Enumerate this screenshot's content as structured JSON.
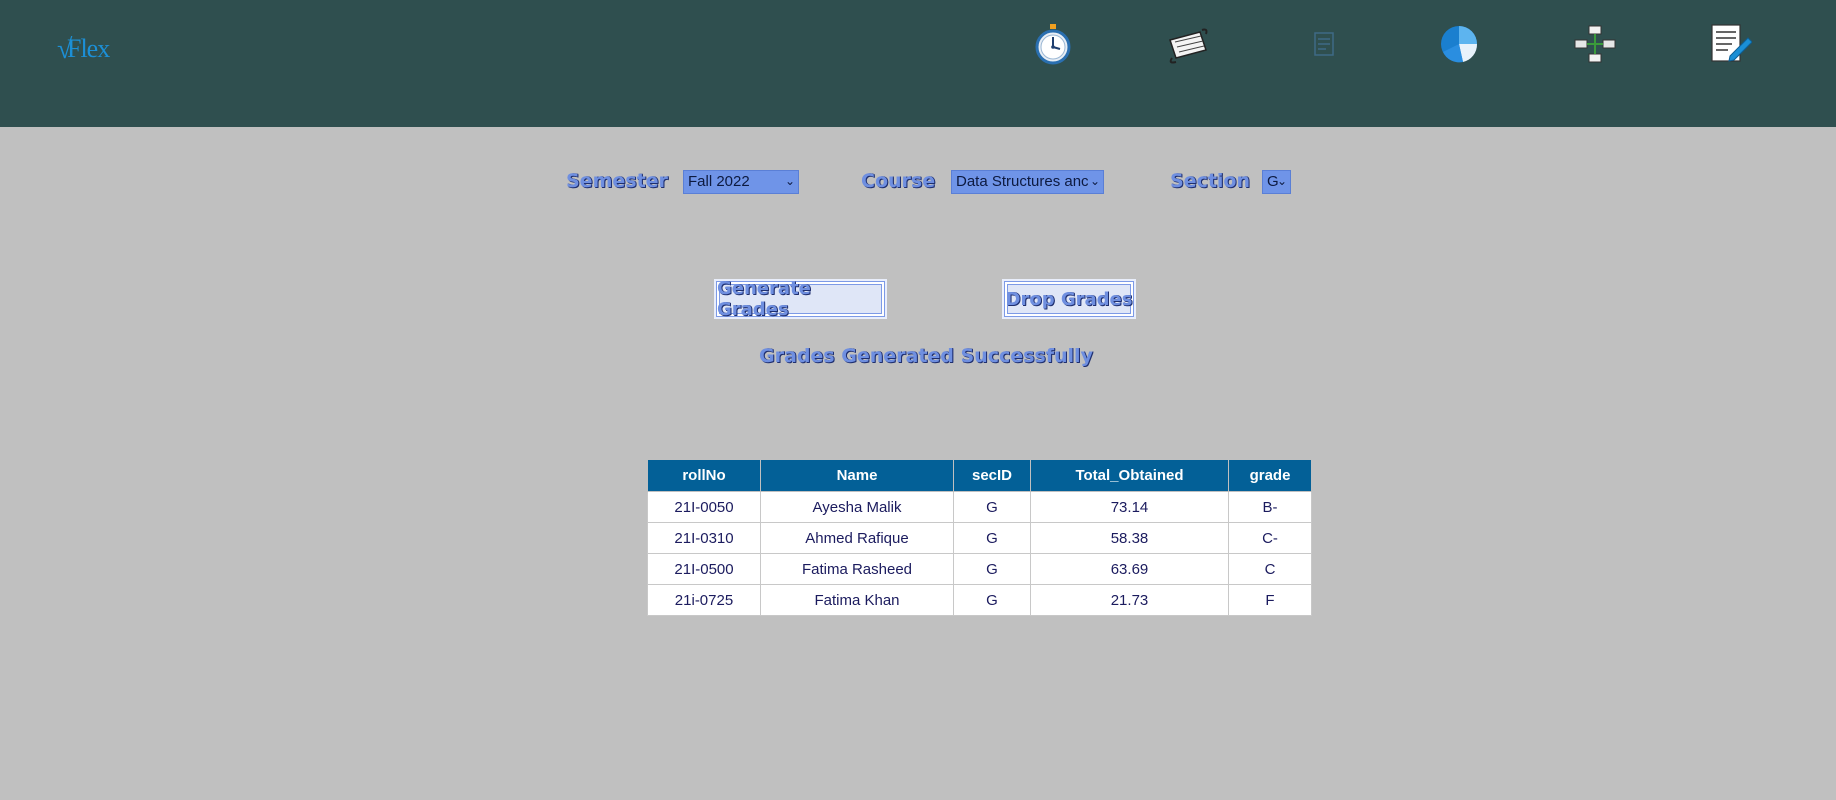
{
  "header": {
    "logo_text": "Flex",
    "nav": [
      {
        "name": "stopwatch-icon"
      },
      {
        "name": "calendar-pen-icon"
      },
      {
        "name": "document-icon"
      },
      {
        "name": "pie-chart-icon"
      },
      {
        "name": "network-icon"
      },
      {
        "name": "edit-document-icon"
      }
    ]
  },
  "filters": {
    "semester_label": "Semester",
    "semester_value": "Fall 2022",
    "course_label": "Course",
    "course_value": "Data Structures anc",
    "section_label": "Section",
    "section_value": "G"
  },
  "actions": {
    "generate_label": "Generate Grades",
    "drop_label": "Drop Grades"
  },
  "status_message": "Grades Generated Successfully",
  "table": {
    "columns": [
      "rollNo",
      "Name",
      "secID",
      "Total_Obtained",
      "grade"
    ],
    "rows": [
      [
        "21I-0050",
        "Ayesha Malik",
        "G",
        "73.14",
        "B-"
      ],
      [
        "21I-0310",
        "Ahmed Rafique",
        "G",
        "58.38",
        "C-"
      ],
      [
        "21I-0500",
        "Fatima Rasheed",
        "G",
        "63.69",
        "C"
      ],
      [
        "21i-0725",
        "Fatima Khan",
        "G",
        "21.73",
        "F"
      ]
    ]
  },
  "colors": {
    "header_bg": "#2f4f4f",
    "page_bg": "#c0c0c0",
    "table_header_bg": "#036097",
    "select_bg": "#6f94e8"
  }
}
